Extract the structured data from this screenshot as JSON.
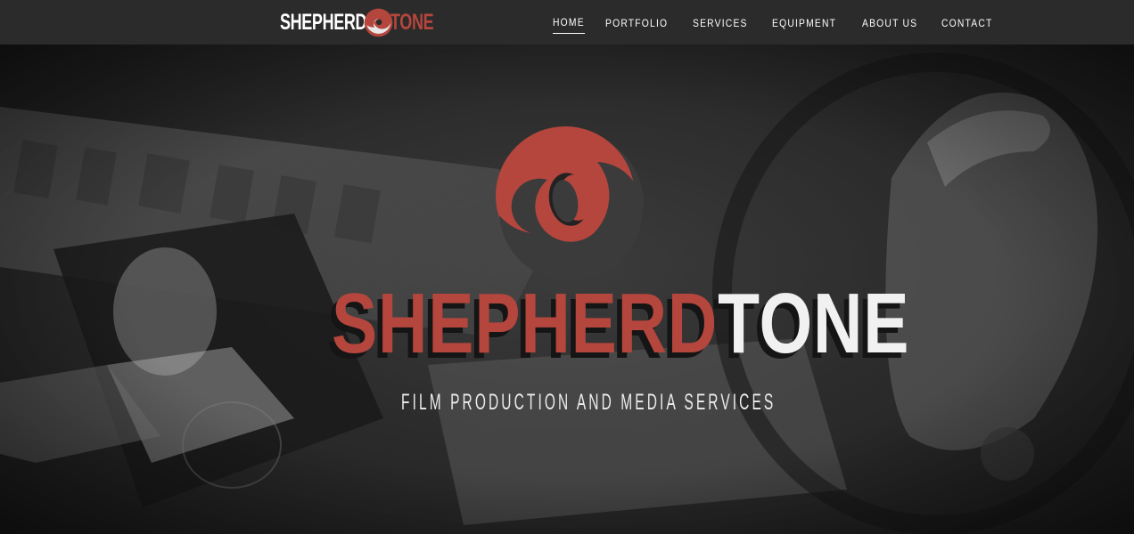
{
  "brand": {
    "name_first": "SHEPHERD",
    "name_second": "TONE"
  },
  "nav": {
    "items": [
      {
        "label": "HOME",
        "active": true
      },
      {
        "label": "PORTFOLIO",
        "active": false
      },
      {
        "label": "SERVICES",
        "active": false
      },
      {
        "label": "EQUIPMENT",
        "active": false
      },
      {
        "label": "ABOUT US",
        "active": false
      },
      {
        "label": "CONTACT",
        "active": false
      }
    ]
  },
  "hero": {
    "title_first": "SHEPHERD",
    "title_second": "TONE",
    "tagline": "FILM PRODUCTION AND MEDIA SERVICES"
  },
  "colors": {
    "accent": "#b5463d",
    "logo_dark": "#3b3b3b",
    "navbar": "#2b2b2b",
    "text": "#f1f1f1"
  },
  "icons": {
    "brand_logo": "swirl-logo-icon"
  }
}
